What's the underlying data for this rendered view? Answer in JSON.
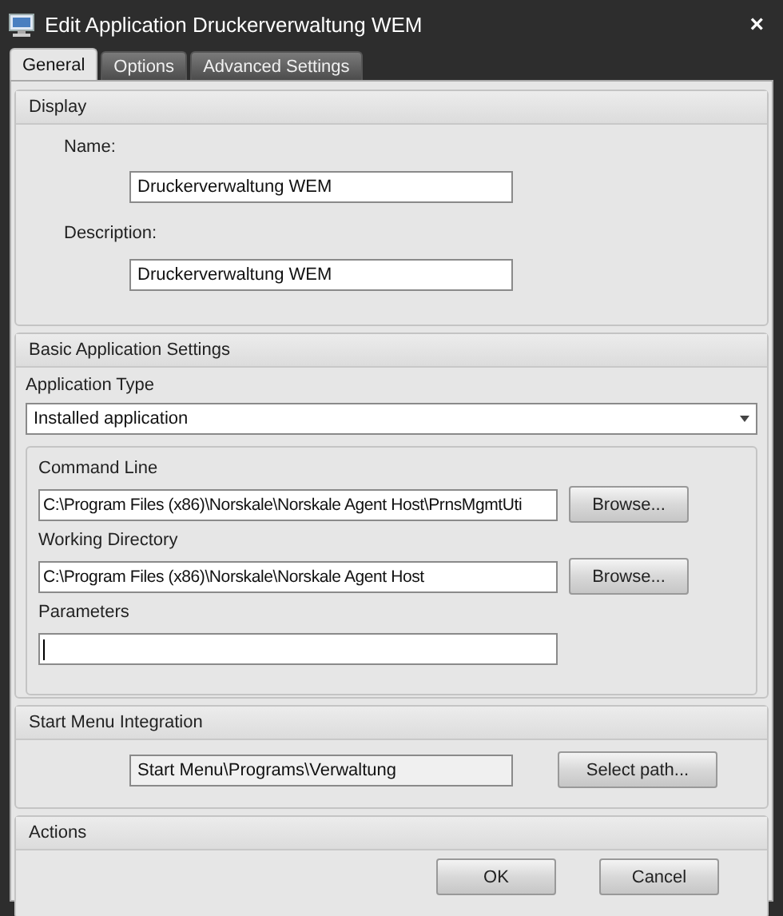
{
  "window": {
    "title": "Edit Application Druckerverwaltung WEM",
    "close": "×"
  },
  "tabs": [
    {
      "label": "General",
      "selected": true
    },
    {
      "label": "Options",
      "selected": false
    },
    {
      "label": "Advanced Settings",
      "selected": false
    }
  ],
  "display": {
    "title": "Display",
    "name_label": "Name:",
    "name_value": "Druckerverwaltung WEM",
    "description_label": "Description:",
    "description_value": "Druckerverwaltung WEM"
  },
  "basic": {
    "title": "Basic Application Settings",
    "type_label": "Application Type",
    "type_value": "Installed application",
    "command_label": "Command Line",
    "command_value": "C:\\Program Files (x86)\\Norskale\\Norskale Agent Host\\PrnsMgmtUti",
    "command_button": "Browse...",
    "workdir_label": "Working Directory",
    "workdir_value": "C:\\Program Files (x86)\\Norskale\\Norskale Agent Host",
    "workdir_button": "Browse...",
    "parameters_label": "Parameters"
  },
  "start_menu": {
    "title": "Start Menu Integration",
    "path_value": "Start Menu\\Programs\\Verwaltung",
    "button": "Select path..."
  },
  "actions": {
    "title": "Actions",
    "buttons": [
      "OK",
      "Cancel"
    ]
  }
}
